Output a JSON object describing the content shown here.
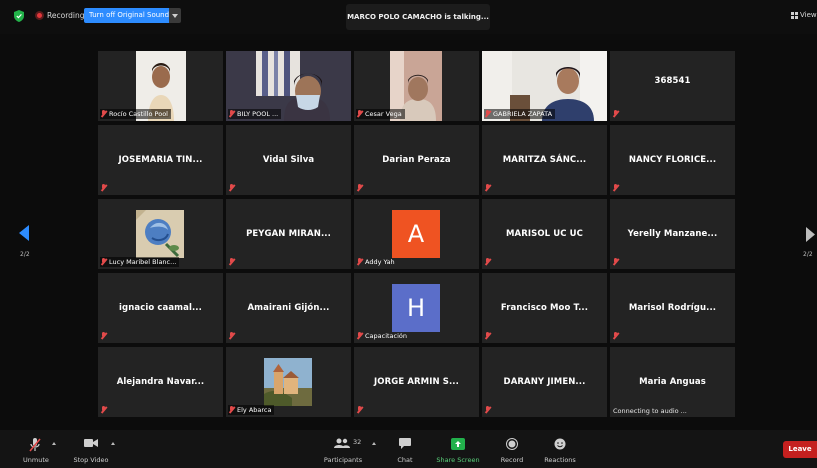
{
  "topbar": {
    "recording_label": "Recording",
    "sound_button": "Turn off Original Sound",
    "talking_banner": "MARCO POLO CAMACHO is talking...",
    "view_label": "View"
  },
  "pagination": {
    "left_page": "2/2",
    "right_page": "2/2"
  },
  "tiles": {
    "r0c0": {
      "label": "Rocío Castillo Pool"
    },
    "r0c1": {
      "label": "BILY POOL ..."
    },
    "r0c2": {
      "label": "Cesar Vega"
    },
    "r0c3": {
      "label": "GABRIELA ZAPATA"
    },
    "r0c4": {
      "name": "368541"
    },
    "r1c0": {
      "name": "JOSEMARIA TIN..."
    },
    "r1c1": {
      "name": "Vidal Silva"
    },
    "r1c2": {
      "name": "Darian Peraza"
    },
    "r1c3": {
      "name": "MARITZA SÁNC..."
    },
    "r1c4": {
      "name": "NANCY FLORICE..."
    },
    "r2c0": {
      "label": "Lucy Maribel Blanc..."
    },
    "r2c1": {
      "name": "PEYGAN MIRAN..."
    },
    "r2c2": {
      "label": "Addy Yah",
      "letter": "A"
    },
    "r2c3": {
      "name": "MARISOL UC UC"
    },
    "r2c4": {
      "name": "Yerelly Manzane..."
    },
    "r3c0": {
      "name": "ignacio caamal..."
    },
    "r3c1": {
      "name": "Amairani Gijón..."
    },
    "r3c2": {
      "label": "Capacitación",
      "letter": "H"
    },
    "r3c3": {
      "name": "Francisco Moo T..."
    },
    "r3c4": {
      "name": "Marisol Rodrígu..."
    },
    "r4c0": {
      "name": "Alejandra Navar..."
    },
    "r4c1": {
      "label": "Ely Abarca"
    },
    "r4c2": {
      "name": "JORGE ARMIN S..."
    },
    "r4c3": {
      "name": "DARANY JIMEN..."
    },
    "r4c4": {
      "name": "Maria Anguas",
      "status": "Connecting to audio ..."
    }
  },
  "colors": {
    "accent_blue": "#2d8cff",
    "letter_a_bg": "#ef5322",
    "letter_h_bg": "#5b6ec9",
    "leave_red": "#c5201f",
    "share_green": "#22b14c"
  },
  "toolbar": {
    "unmute": "Unmute",
    "stop_video": "Stop Video",
    "participants": "Participants",
    "participants_count": "32",
    "chat": "Chat",
    "share_screen": "Share Screen",
    "record": "Record",
    "reactions": "Reactions",
    "leave": "Leave"
  }
}
